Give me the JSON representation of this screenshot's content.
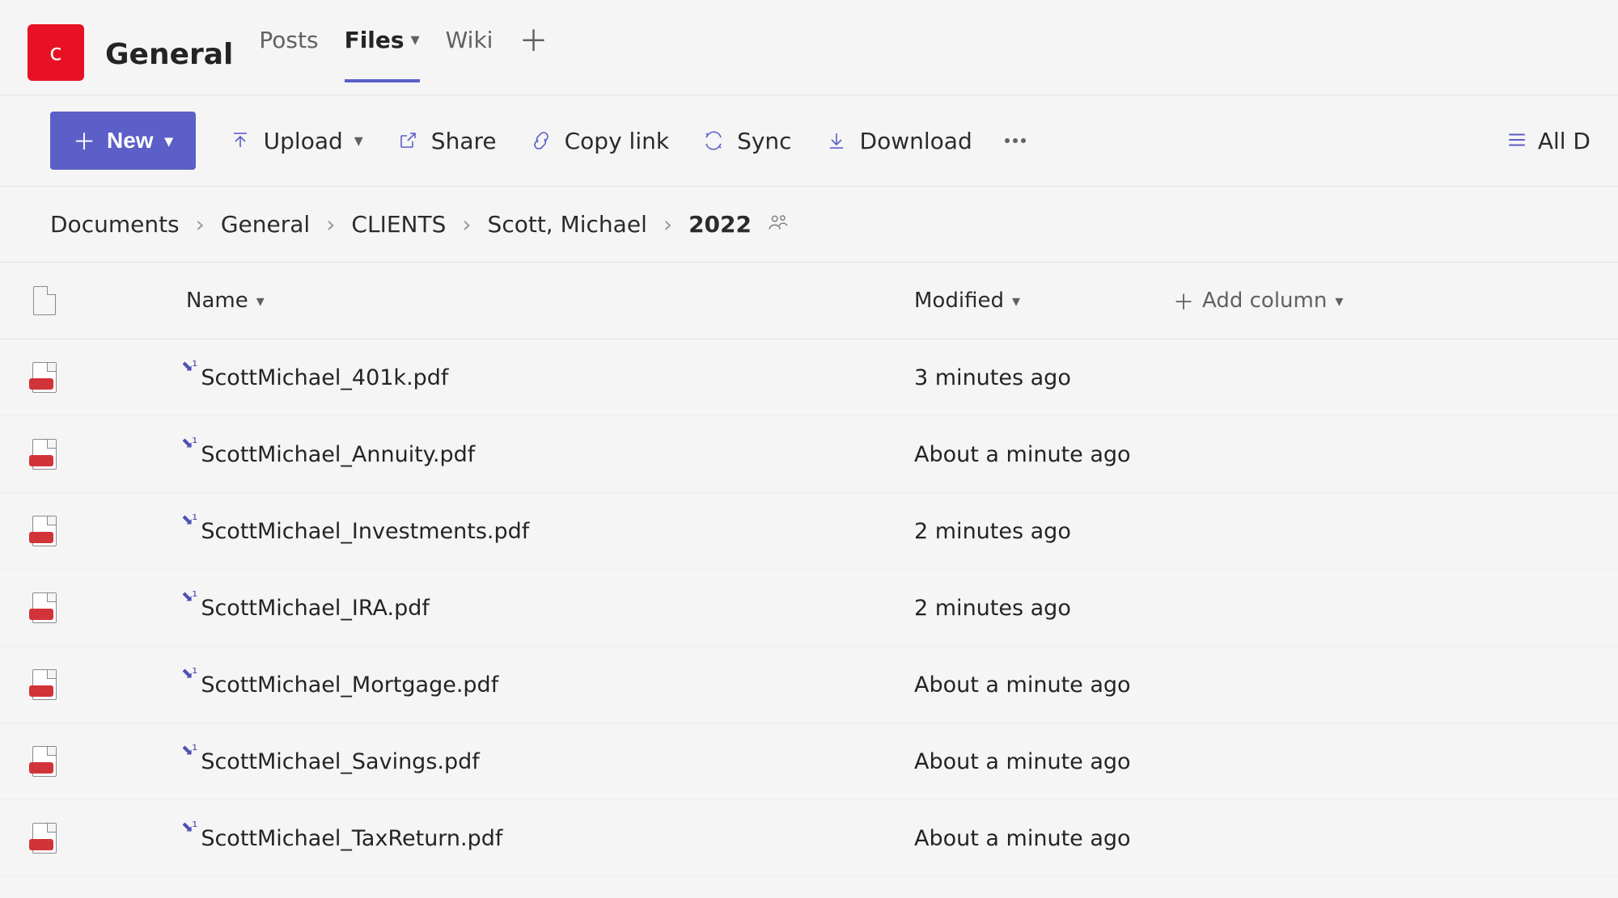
{
  "header": {
    "tile_letter": "c",
    "title": "General",
    "tabs": [
      {
        "label": "Posts",
        "active": false,
        "has_chevron": false
      },
      {
        "label": "Files",
        "active": true,
        "has_chevron": true
      },
      {
        "label": "Wiki",
        "active": false,
        "has_chevron": false
      }
    ]
  },
  "commands": {
    "new_label": "New",
    "upload_label": "Upload",
    "share_label": "Share",
    "copy_link_label": "Copy link",
    "sync_label": "Sync",
    "download_label": "Download",
    "view_label": "All D"
  },
  "breadcrumb": {
    "items": [
      "Documents",
      "General",
      "CLIENTS",
      "Scott, Michael",
      "2022"
    ]
  },
  "columns": {
    "name_label": "Name",
    "modified_label": "Modified",
    "add_column_label": "Add column"
  },
  "files": [
    {
      "name": "ScottMichael_401k.pdf",
      "modified": "3 minutes ago",
      "is_new": true
    },
    {
      "name": "ScottMichael_Annuity.pdf",
      "modified": "About a minute ago",
      "is_new": true
    },
    {
      "name": "ScottMichael_Investments.pdf",
      "modified": "2 minutes ago",
      "is_new": true
    },
    {
      "name": "ScottMichael_IRA.pdf",
      "modified": "2 minutes ago",
      "is_new": true
    },
    {
      "name": "ScottMichael_Mortgage.pdf",
      "modified": "About a minute ago",
      "is_new": true
    },
    {
      "name": "ScottMichael_Savings.pdf",
      "modified": "About a minute ago",
      "is_new": true
    },
    {
      "name": "ScottMichael_TaxReturn.pdf",
      "modified": "About a minute ago",
      "is_new": true
    }
  ]
}
